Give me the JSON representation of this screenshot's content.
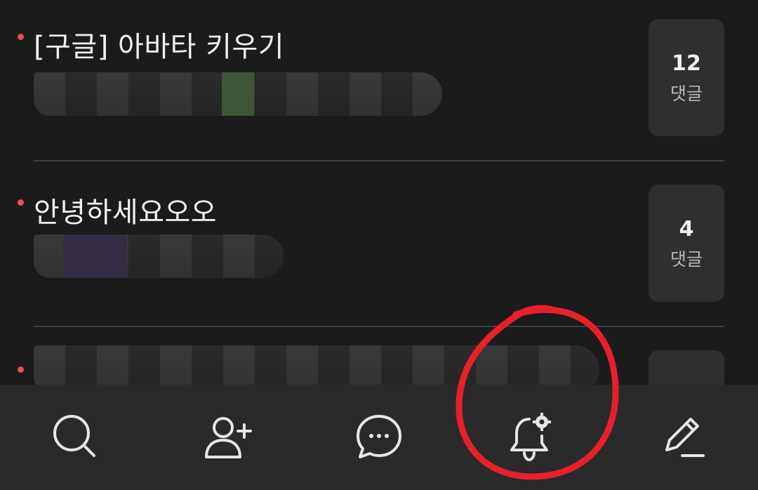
{
  "posts": [
    {
      "title": "[구글] 아바타 키우기",
      "comment_count": "12",
      "comment_label": "댓글"
    },
    {
      "title": "안녕하세요오오",
      "comment_count": "4",
      "comment_label": "댓글"
    }
  ],
  "nav": {
    "icons": [
      "search-icon",
      "add-friend-icon",
      "chat-icon",
      "notification-settings-icon",
      "write-icon"
    ]
  },
  "colors": {
    "background": "#1b1b1c",
    "nav_background": "#2a2a2b",
    "card": "#2f2f30",
    "bullet": "#e0554a",
    "annotation": "#e8202a"
  }
}
